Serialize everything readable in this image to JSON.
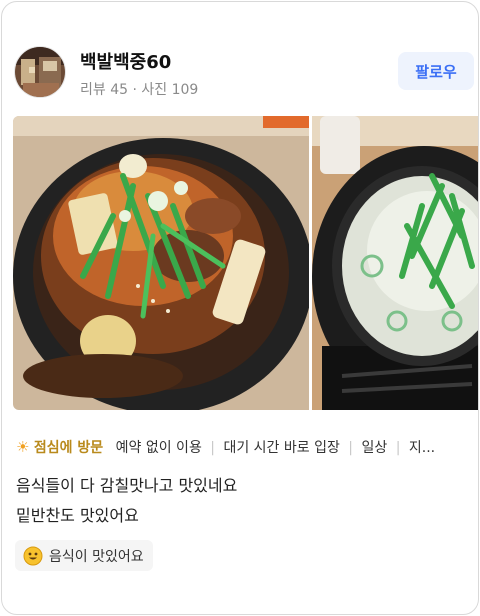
{
  "user": {
    "name": "백발백중60",
    "stats": "리뷰 45 · 사진 109",
    "follow_label": "팔로우"
  },
  "tags": {
    "visit": "점심에 방문",
    "items": [
      "예약 없이 이용",
      "대기 시간 바로 입장",
      "일상",
      "지..."
    ]
  },
  "review": {
    "line1": "음식들이 다 감칠맛나고 맛있네요",
    "line2": "밑반찬도 맛있어요"
  },
  "chip": {
    "label": "음식이 맛있어요",
    "icon": "smile-emoji-icon"
  },
  "colors": {
    "accent_blue": "#3b6ff5",
    "follow_bg": "#eef3fd",
    "tag_highlight": "#b98a1c"
  }
}
